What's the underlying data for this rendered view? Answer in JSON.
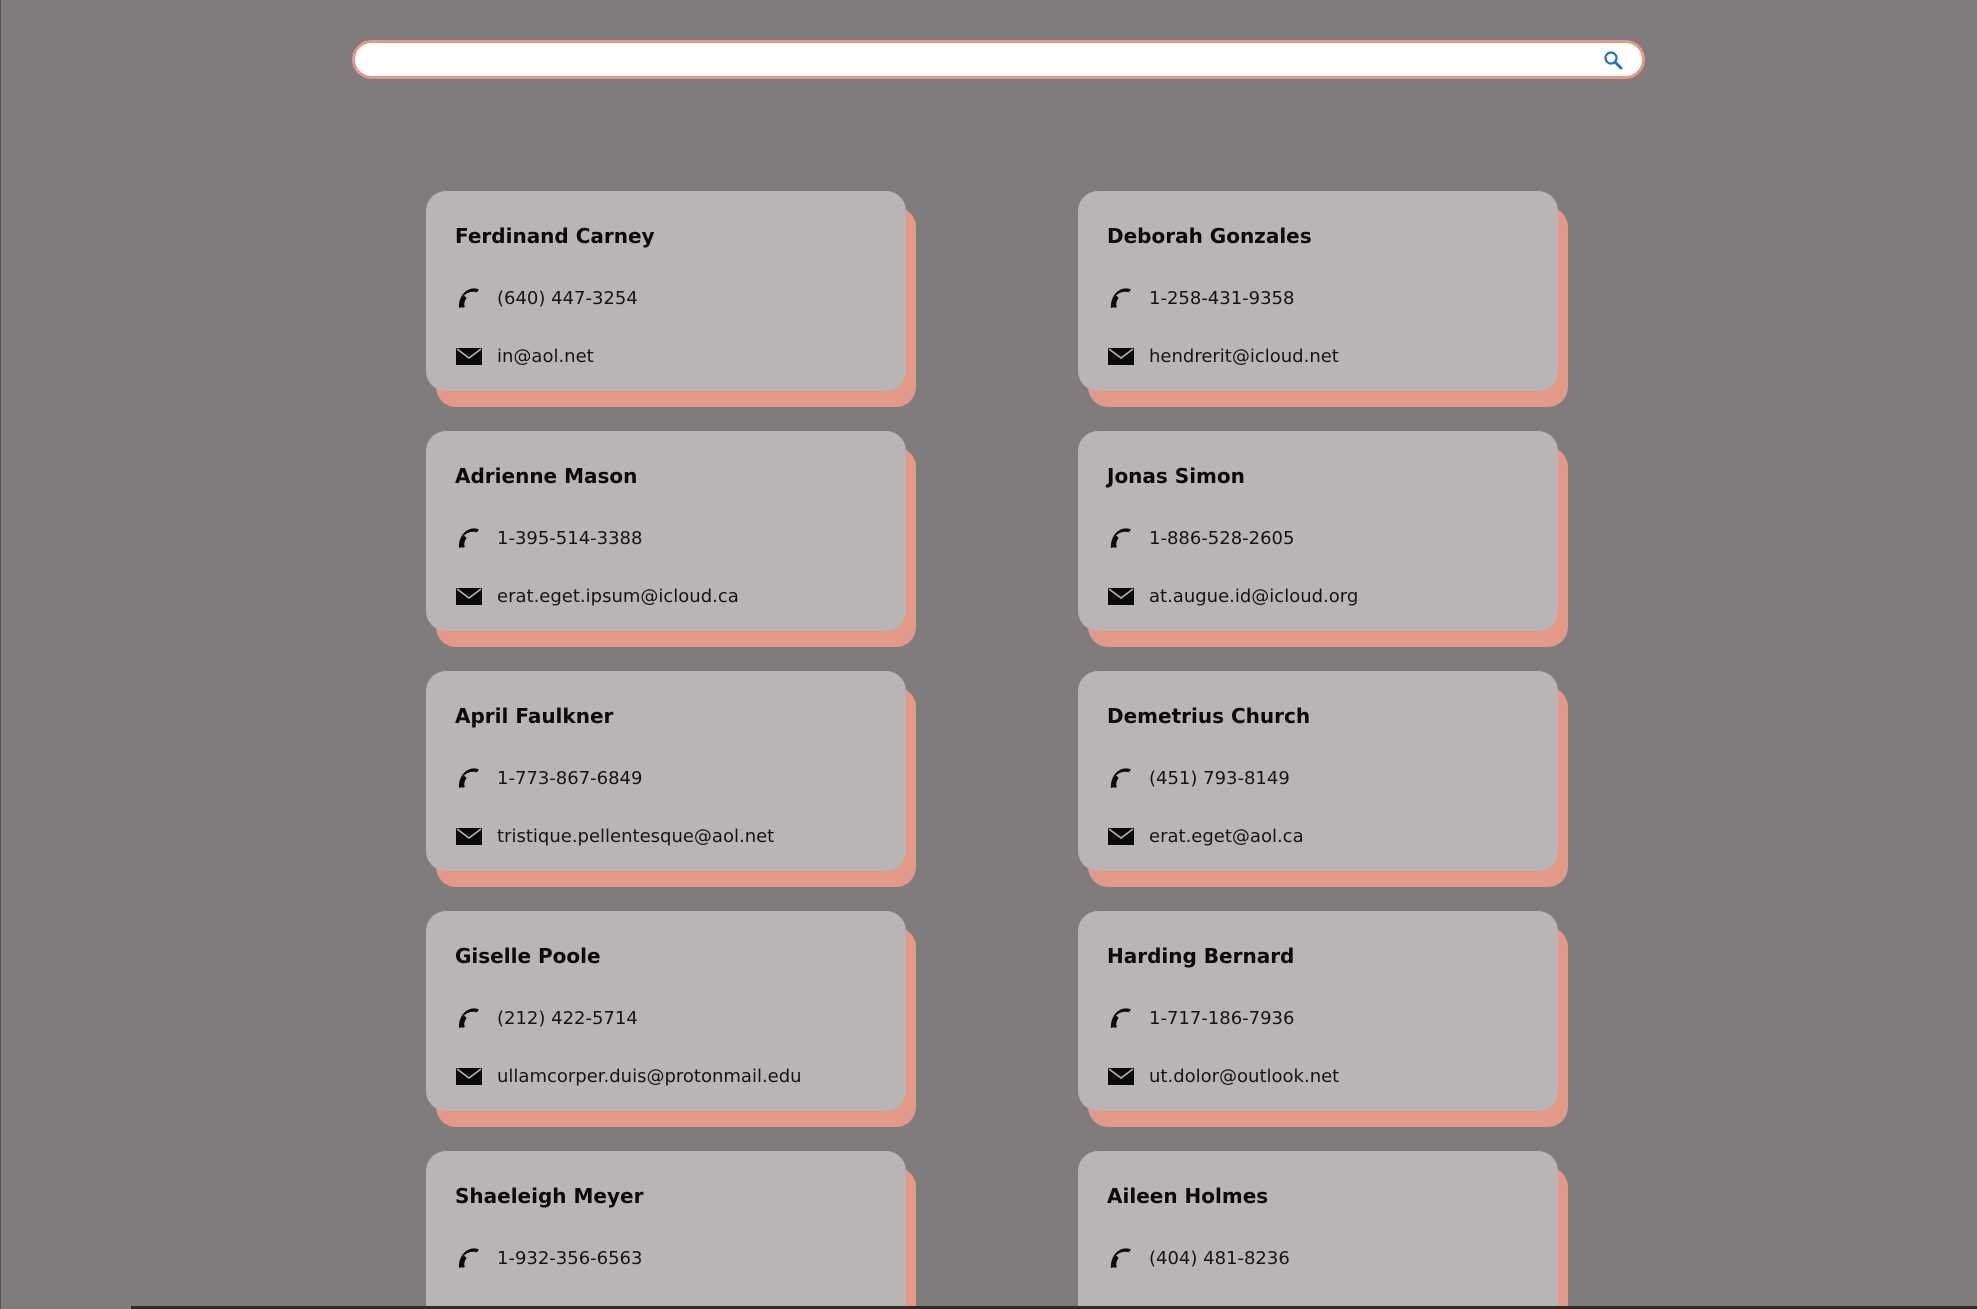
{
  "search": {
    "value": "",
    "icon": "search-icon"
  },
  "colors": {
    "background": "#807c7b",
    "card": "#bab5b4",
    "card_shadow": "#e3998a",
    "search_border": "#e3998a",
    "search_icon": "#1e72c8"
  },
  "contacts": [
    {
      "name": "Ferdinand Carney",
      "phone": "(640) 447-3254",
      "email": "in@aol.net"
    },
    {
      "name": "Deborah Gonzales",
      "phone": "1-258-431-9358",
      "email": "hendrerit@icloud.net"
    },
    {
      "name": "Adrienne Mason",
      "phone": "1-395-514-3388",
      "email": "erat.eget.ipsum@icloud.ca"
    },
    {
      "name": "Jonas Simon",
      "phone": "1-886-528-2605",
      "email": "at.augue.id@icloud.org"
    },
    {
      "name": "April Faulkner",
      "phone": "1-773-867-6849",
      "email": "tristique.pellentesque@aol.net"
    },
    {
      "name": "Demetrius Church",
      "phone": "(451) 793-8149",
      "email": "erat.eget@aol.ca"
    },
    {
      "name": "Giselle Poole",
      "phone": "(212) 422-5714",
      "email": "ullamcorper.duis@protonmail.edu"
    },
    {
      "name": "Harding Bernard",
      "phone": "1-717-186-7936",
      "email": "ut.dolor@outlook.net"
    },
    {
      "name": "Shaeleigh Meyer",
      "phone": "1-932-356-6563",
      "email": ""
    },
    {
      "name": "Aileen Holmes",
      "phone": "(404) 481-8236",
      "email": ""
    }
  ]
}
